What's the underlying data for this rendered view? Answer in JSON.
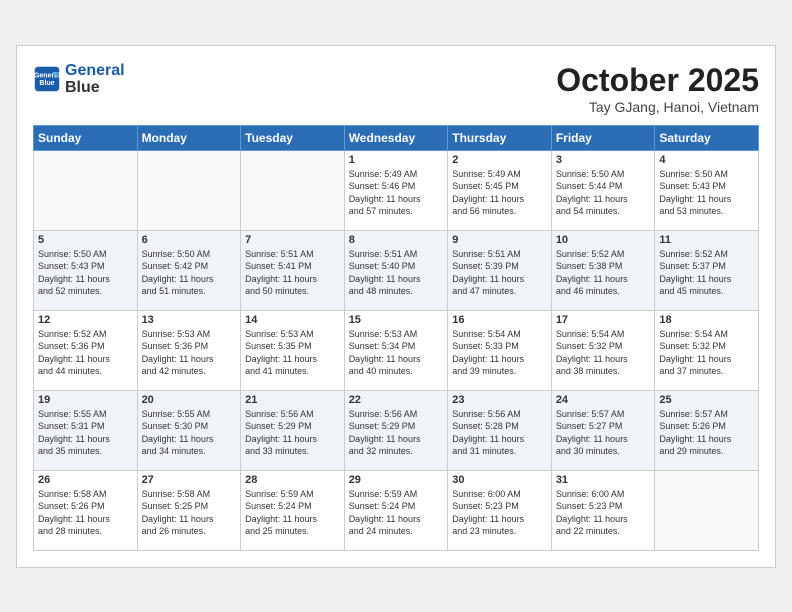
{
  "header": {
    "logo_line1": "General",
    "logo_line2": "Blue",
    "month": "October 2025",
    "location": "Tay GJang, Hanoi, Vietnam"
  },
  "weekdays": [
    "Sunday",
    "Monday",
    "Tuesday",
    "Wednesday",
    "Thursday",
    "Friday",
    "Saturday"
  ],
  "weeks": [
    [
      {
        "day": "",
        "text": ""
      },
      {
        "day": "",
        "text": ""
      },
      {
        "day": "",
        "text": ""
      },
      {
        "day": "1",
        "text": "Sunrise: 5:49 AM\nSunset: 5:46 PM\nDaylight: 11 hours\nand 57 minutes."
      },
      {
        "day": "2",
        "text": "Sunrise: 5:49 AM\nSunset: 5:45 PM\nDaylight: 11 hours\nand 56 minutes."
      },
      {
        "day": "3",
        "text": "Sunrise: 5:50 AM\nSunset: 5:44 PM\nDaylight: 11 hours\nand 54 minutes."
      },
      {
        "day": "4",
        "text": "Sunrise: 5:50 AM\nSunset: 5:43 PM\nDaylight: 11 hours\nand 53 minutes."
      }
    ],
    [
      {
        "day": "5",
        "text": "Sunrise: 5:50 AM\nSunset: 5:43 PM\nDaylight: 11 hours\nand 52 minutes."
      },
      {
        "day": "6",
        "text": "Sunrise: 5:50 AM\nSunset: 5:42 PM\nDaylight: 11 hours\nand 51 minutes."
      },
      {
        "day": "7",
        "text": "Sunrise: 5:51 AM\nSunset: 5:41 PM\nDaylight: 11 hours\nand 50 minutes."
      },
      {
        "day": "8",
        "text": "Sunrise: 5:51 AM\nSunset: 5:40 PM\nDaylight: 11 hours\nand 48 minutes."
      },
      {
        "day": "9",
        "text": "Sunrise: 5:51 AM\nSunset: 5:39 PM\nDaylight: 11 hours\nand 47 minutes."
      },
      {
        "day": "10",
        "text": "Sunrise: 5:52 AM\nSunset: 5:38 PM\nDaylight: 11 hours\nand 46 minutes."
      },
      {
        "day": "11",
        "text": "Sunrise: 5:52 AM\nSunset: 5:37 PM\nDaylight: 11 hours\nand 45 minutes."
      }
    ],
    [
      {
        "day": "12",
        "text": "Sunrise: 5:52 AM\nSunset: 5:36 PM\nDaylight: 11 hours\nand 44 minutes."
      },
      {
        "day": "13",
        "text": "Sunrise: 5:53 AM\nSunset: 5:36 PM\nDaylight: 11 hours\nand 42 minutes."
      },
      {
        "day": "14",
        "text": "Sunrise: 5:53 AM\nSunset: 5:35 PM\nDaylight: 11 hours\nand 41 minutes."
      },
      {
        "day": "15",
        "text": "Sunrise: 5:53 AM\nSunset: 5:34 PM\nDaylight: 11 hours\nand 40 minutes."
      },
      {
        "day": "16",
        "text": "Sunrise: 5:54 AM\nSunset: 5:33 PM\nDaylight: 11 hours\nand 39 minutes."
      },
      {
        "day": "17",
        "text": "Sunrise: 5:54 AM\nSunset: 5:32 PM\nDaylight: 11 hours\nand 38 minutes."
      },
      {
        "day": "18",
        "text": "Sunrise: 5:54 AM\nSunset: 5:32 PM\nDaylight: 11 hours\nand 37 minutes."
      }
    ],
    [
      {
        "day": "19",
        "text": "Sunrise: 5:55 AM\nSunset: 5:31 PM\nDaylight: 11 hours\nand 35 minutes."
      },
      {
        "day": "20",
        "text": "Sunrise: 5:55 AM\nSunset: 5:30 PM\nDaylight: 11 hours\nand 34 minutes."
      },
      {
        "day": "21",
        "text": "Sunrise: 5:56 AM\nSunset: 5:29 PM\nDaylight: 11 hours\nand 33 minutes."
      },
      {
        "day": "22",
        "text": "Sunrise: 5:56 AM\nSunset: 5:29 PM\nDaylight: 11 hours\nand 32 minutes."
      },
      {
        "day": "23",
        "text": "Sunrise: 5:56 AM\nSunset: 5:28 PM\nDaylight: 11 hours\nand 31 minutes."
      },
      {
        "day": "24",
        "text": "Sunrise: 5:57 AM\nSunset: 5:27 PM\nDaylight: 11 hours\nand 30 minutes."
      },
      {
        "day": "25",
        "text": "Sunrise: 5:57 AM\nSunset: 5:26 PM\nDaylight: 11 hours\nand 29 minutes."
      }
    ],
    [
      {
        "day": "26",
        "text": "Sunrise: 5:58 AM\nSunset: 5:26 PM\nDaylight: 11 hours\nand 28 minutes."
      },
      {
        "day": "27",
        "text": "Sunrise: 5:58 AM\nSunset: 5:25 PM\nDaylight: 11 hours\nand 26 minutes."
      },
      {
        "day": "28",
        "text": "Sunrise: 5:59 AM\nSunset: 5:24 PM\nDaylight: 11 hours\nand 25 minutes."
      },
      {
        "day": "29",
        "text": "Sunrise: 5:59 AM\nSunset: 5:24 PM\nDaylight: 11 hours\nand 24 minutes."
      },
      {
        "day": "30",
        "text": "Sunrise: 6:00 AM\nSunset: 5:23 PM\nDaylight: 11 hours\nand 23 minutes."
      },
      {
        "day": "31",
        "text": "Sunrise: 6:00 AM\nSunset: 5:23 PM\nDaylight: 11 hours\nand 22 minutes."
      },
      {
        "day": "",
        "text": ""
      }
    ]
  ]
}
